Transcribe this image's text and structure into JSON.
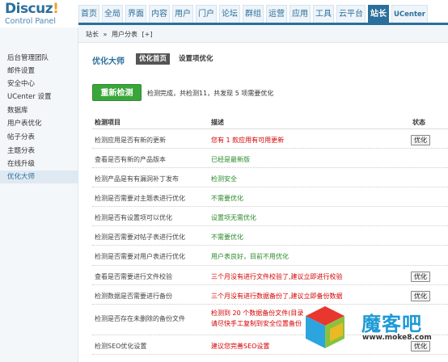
{
  "logo": {
    "title": "Discuz",
    "bang": "!",
    "subtitle": "Control Panel"
  },
  "topnav": [
    "首页",
    "全局",
    "界面",
    "内容",
    "用户",
    "门户",
    "论坛",
    "群组",
    "运营",
    "应用",
    "工具",
    "云平台",
    "站长",
    "UCenter"
  ],
  "topnav_active": "站长",
  "breadcrumb": {
    "parts": [
      "站长",
      "»",
      "用户分表",
      "[+]"
    ]
  },
  "sidebar": {
    "items": [
      "后台管理团队",
      "邮件设置",
      "安全中心",
      "UCenter 设置",
      "数据库",
      "用户表优化",
      "帖子分表",
      "主题分表",
      "在线升级",
      "优化大师"
    ],
    "active": "优化大师"
  },
  "main": {
    "title": "优化大师",
    "tabs": [
      {
        "label": "优化首页",
        "active": true
      },
      {
        "label": "设置项优化",
        "active": false
      }
    ],
    "recheck_label": "重新检测",
    "summary": "检测完成，共检测11，共发现 5 项需要优化"
  },
  "table": {
    "headers": {
      "item": "检测项目",
      "desc": "描述",
      "status": "状态"
    },
    "rows": [
      {
        "item": "检测应用是否有新的更新",
        "desc": "您有 1 款应用有可用更新",
        "desc2": "",
        "color": "red",
        "action": "优化"
      },
      {
        "item": "查看是否有新的产品版本",
        "desc": "已经是最新版",
        "desc2": "",
        "color": "green",
        "action": ""
      },
      {
        "item": "检测产品是有有漏洞补丁发布",
        "desc": "检测安全",
        "desc2": "",
        "color": "green",
        "action": ""
      },
      {
        "item": "检测是否需要对主题表进行优化",
        "desc": "不需要优化",
        "desc2": "",
        "color": "green",
        "action": ""
      },
      {
        "item": "检测是否有设置项可以优化",
        "desc": "设置项无需优化",
        "desc2": "",
        "color": "green",
        "action": ""
      },
      {
        "item": "检测是否需要对帖子表进行优化",
        "desc": "不需要优化",
        "desc2": "",
        "color": "green",
        "action": ""
      },
      {
        "item": "检测是否需要对用户表进行优化",
        "desc": "用户表良好，目前不用优化",
        "desc2": "",
        "color": "green",
        "action": ""
      },
      {
        "item": "查看是否需要进行文件校验",
        "desc": "三个月没有进行文件校验了,建议立即进行校验",
        "desc2": "",
        "color": "red",
        "action": "优化"
      },
      {
        "item": "检测数据是否需要进行备份",
        "desc": "三个月没有进行数据备份了,建议立即备份数据",
        "desc2": "",
        "color": "red",
        "action": "优化"
      },
      {
        "item": "检测是否存在未删除的备份文件",
        "desc": "检测到 20 个数据备份文件(目录",
        "desc2": "请尽快手工复制到安全位置备份",
        "color": "red",
        "action": ""
      },
      {
        "item": "检测SEO优化设置",
        "desc": "建议您完善SEO设置",
        "desc2": "",
        "color": "red",
        "action": "优化"
      }
    ]
  },
  "watermark": {
    "text": "魔客吧",
    "url": "www.moke8.com"
  },
  "colors": {
    "brand_blue": "#2b6f9c",
    "green_button": "#3aa63a",
    "alert_red": "#d40000",
    "ok_green": "#2a8a2a"
  }
}
